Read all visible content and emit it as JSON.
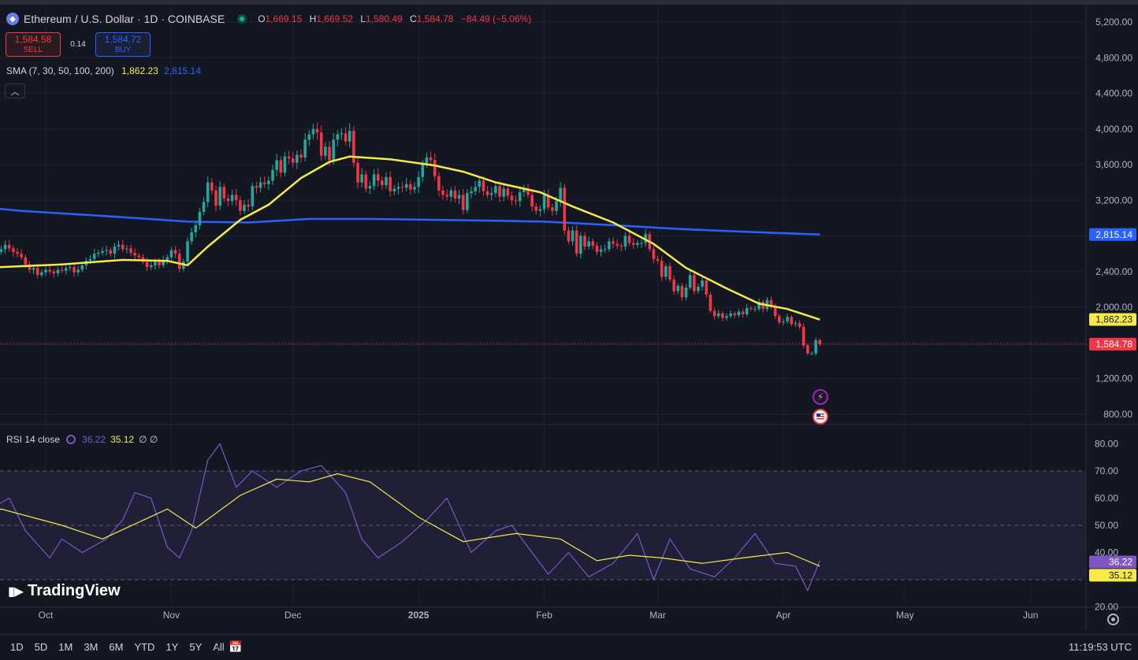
{
  "header": {
    "title": "Ethereum / U.S. Dollar · 1D · COINBASE",
    "ohlc": [
      {
        "k": "O",
        "v": "1,669.15"
      },
      {
        "k": "H",
        "v": "1,669.52"
      },
      {
        "k": "L",
        "v": "1,580.49"
      },
      {
        "k": "C",
        "v": "1,584.78"
      },
      {
        "k": "",
        "v": "−84.49 (−5.06%)"
      }
    ]
  },
  "trade": {
    "sell_price": "1,584.58",
    "sell_label": "SELL",
    "spread": "0.14",
    "buy_price": "1,584.72",
    "buy_label": "BUY"
  },
  "sma": {
    "label": "SMA (7, 30, 50, 100, 200)",
    "value1": "1,862.23",
    "value2": "2,815.14"
  },
  "rsi": {
    "label": "RSI 14 close",
    "value1": "36.22",
    "value2": "35.12",
    "extra": "∅ ∅"
  },
  "colors": {
    "up": "#26a69a",
    "down": "#f23645",
    "sma_short": "#f7e94a",
    "sma_long": "#2962ff",
    "rsi": "#7e57c2"
  },
  "logo": {
    "text": "TradingView"
  },
  "bottom": {
    "ranges": [
      "1D",
      "5D",
      "1M",
      "3M",
      "6M",
      "YTD",
      "1Y",
      "5Y",
      "All"
    ],
    "clock": "11:19:53 UTC"
  },
  "chart_data": {
    "type": "candlestick",
    "price_axis": {
      "ticks": [
        800,
        1200,
        1600,
        2000,
        2400,
        2800,
        3200,
        3600,
        4000,
        4400,
        4800,
        5200
      ],
      "tick_labels": [
        "800.00",
        "1,200.00",
        "",
        "2,000.00",
        "2,400.00",
        "",
        "3,200.00",
        "3,600.00",
        "4,000.00",
        "4,400.00",
        "4,800.00",
        "5,200.00"
      ],
      "range": [
        640,
        5360
      ]
    },
    "price_labels": [
      {
        "value": 2815.14,
        "text": "2,815.14",
        "color": "#2962ff",
        "text_color": "#ffffff"
      },
      {
        "value": 1862.23,
        "text": "1,862.23",
        "color": "#f7e94a",
        "text_color": "#131722"
      },
      {
        "value": 1584.78,
        "text": "1,584.78",
        "color": "#f23645",
        "text_color": "#ffffff"
      }
    ],
    "last_price": 1584.78,
    "time_axis": [
      "Oct",
      "Nov",
      "Dec",
      "2025",
      "Feb",
      "Mar",
      "Apr",
      "May",
      "Jun"
    ],
    "time_axis_dates": [
      "2024-10-01",
      "2024-11-01",
      "2024-12-01",
      "2025-01-01",
      "2025-02-01",
      "2025-03-01",
      "2025-04-01",
      "2025-05-01",
      "2025-06-01"
    ],
    "date_range": [
      "2024-09-06",
      "2025-06-21"
    ],
    "last_candle_date": "2025-04-10",
    "closes": [
      2430,
      2470,
      2480,
      2500,
      2520,
      2560,
      2580,
      2590,
      2610,
      2640,
      2660,
      2620,
      2590,
      2600,
      2620,
      2650,
      2700,
      2660,
      2620,
      2600,
      2560,
      2480,
      2420,
      2440,
      2360,
      2390,
      2420,
      2400,
      2380,
      2420,
      2410,
      2440,
      2450,
      2390,
      2420,
      2470,
      2520,
      2540,
      2600,
      2610,
      2630,
      2640,
      2600,
      2680,
      2700,
      2650,
      2660,
      2610,
      2580,
      2560,
      2510,
      2450,
      2470,
      2510,
      2470,
      2530,
      2560,
      2640,
      2600,
      2430,
      2510,
      2740,
      2840,
      2920,
      3070,
      3180,
      3400,
      3310,
      3140,
      3350,
      3220,
      3190,
      3260,
      3200,
      3080,
      3150,
      3130,
      3360,
      3340,
      3400,
      3380,
      3420,
      3540,
      3650,
      3510,
      3690,
      3670,
      3620,
      3710,
      3680,
      3880,
      3940,
      4000,
      3960,
      3700,
      3800,
      3650,
      3880,
      3940,
      3950,
      3860,
      3980,
      3620,
      3400,
      3490,
      3330,
      3360,
      3490,
      3420,
      3370,
      3460,
      3300,
      3330,
      3350,
      3340,
      3380,
      3320,
      3350,
      3460,
      3610,
      3680,
      3650,
      3470,
      3310,
      3260,
      3240,
      3310,
      3220,
      3260,
      3090,
      3280,
      3300,
      3350,
      3420,
      3300,
      3260,
      3280,
      3360,
      3240,
      3330,
      3250,
      3200,
      3190,
      3290,
      3330,
      3260,
      3130,
      3080,
      3100,
      3260,
      3120,
      3080,
      3190,
      3340,
      2860,
      2740,
      2860,
      2600,
      2800,
      2680,
      2740,
      2690,
      2620,
      2650,
      2650,
      2740,
      2710,
      2690,
      2680,
      2800,
      2720,
      2700,
      2720,
      2720,
      2820,
      2650,
      2540,
      2520,
      2340,
      2460,
      2310,
      2180,
      2240,
      2110,
      2220,
      2360,
      2180,
      2230,
      2300,
      2140,
      1960,
      1900,
      1930,
      1880,
      1900,
      1930,
      1910,
      1950,
      1920,
      1990,
      1980,
      1980,
      2060,
      1980,
      2080,
      2000,
      1900,
      1830,
      1840,
      1890,
      1810,
      1820,
      1780,
      1570,
      1480,
      1480,
      1630,
      1584
    ],
    "sma_short": {
      "name": "SMA",
      "points": [
        [
          "2024-09-06",
          2460
        ],
        [
          "2024-09-20",
          2450
        ],
        [
          "2024-10-05",
          2480
        ],
        [
          "2024-10-20",
          2530
        ],
        [
          "2024-10-31",
          2520
        ],
        [
          "2024-11-05",
          2470
        ],
        [
          "2024-11-10",
          2680
        ],
        [
          "2024-11-18",
          2980
        ],
        [
          "2024-11-25",
          3150
        ],
        [
          "2024-12-03",
          3450
        ],
        [
          "2024-12-10",
          3630
        ],
        [
          "2024-12-15",
          3690
        ],
        [
          "2024-12-25",
          3660
        ],
        [
          "2025-01-05",
          3590
        ],
        [
          "2025-01-12",
          3520
        ],
        [
          "2025-01-20",
          3400
        ],
        [
          "2025-01-31",
          3290
        ],
        [
          "2025-02-08",
          3130
        ],
        [
          "2025-02-18",
          2950
        ],
        [
          "2025-02-28",
          2710
        ],
        [
          "2025-03-08",
          2440
        ],
        [
          "2025-03-18",
          2210
        ],
        [
          "2025-03-26",
          2040
        ],
        [
          "2025-04-02",
          1980
        ],
        [
          "2025-04-10",
          1860
        ]
      ]
    },
    "sma_long": {
      "name": "SMA",
      "points": [
        [
          "2024-09-06",
          3160
        ],
        [
          "2024-09-25",
          3080
        ],
        [
          "2024-10-20",
          3010
        ],
        [
          "2024-11-05",
          2960
        ],
        [
          "2024-11-20",
          2950
        ],
        [
          "2024-12-05",
          2990
        ],
        [
          "2024-12-20",
          2990
        ],
        [
          "2025-01-05",
          2980
        ],
        [
          "2025-01-20",
          2970
        ],
        [
          "2025-02-01",
          2960
        ],
        [
          "2025-02-18",
          2920
        ],
        [
          "2025-03-05",
          2880
        ],
        [
          "2025-03-20",
          2850
        ],
        [
          "2025-04-10",
          2815
        ]
      ]
    },
    "rsi": {
      "axis_ticks": [
        20,
        30,
        40,
        50,
        60,
        70,
        80
      ],
      "axis_labels": [
        "20.00",
        "",
        "40.00",
        "50.00",
        "60.00",
        "70.00",
        "80.00"
      ],
      "range": [
        18,
        82
      ],
      "band": [
        30,
        70
      ],
      "value_labels": [
        {
          "value": 36.22,
          "text": "36.22",
          "color": "#7e57c2",
          "text_color": "#ffffff"
        },
        {
          "value": 35.12,
          "text": "35.12",
          "color": "#f7e94a",
          "text_color": "#131722"
        }
      ],
      "rsi_points": [
        [
          "2024-09-06",
          58
        ],
        [
          "2024-09-12",
          62
        ],
        [
          "2024-09-16",
          55
        ],
        [
          "2024-09-22",
          60
        ],
        [
          "2024-09-26",
          48
        ],
        [
          "2024-10-02",
          38
        ],
        [
          "2024-10-05",
          45
        ],
        [
          "2024-10-10",
          40
        ],
        [
          "2024-10-16",
          45
        ],
        [
          "2024-10-20",
          52
        ],
        [
          "2024-10-23",
          62
        ],
        [
          "2024-10-27",
          60
        ],
        [
          "2024-10-31",
          42
        ],
        [
          "2024-11-03",
          38
        ],
        [
          "2024-11-06",
          48
        ],
        [
          "2024-11-10",
          74
        ],
        [
          "2024-11-13",
          80
        ],
        [
          "2024-11-17",
          64
        ],
        [
          "2024-11-21",
          70
        ],
        [
          "2024-11-27",
          64
        ],
        [
          "2024-12-03",
          70
        ],
        [
          "2024-12-08",
          72
        ],
        [
          "2024-12-14",
          62
        ],
        [
          "2024-12-18",
          45
        ],
        [
          "2024-12-22",
          38
        ],
        [
          "2024-12-28",
          44
        ],
        [
          "2025-01-03",
          52
        ],
        [
          "2025-01-08",
          60
        ],
        [
          "2025-01-14",
          40
        ],
        [
          "2025-01-20",
          48
        ],
        [
          "2025-01-24",
          50
        ],
        [
          "2025-01-29",
          40
        ],
        [
          "2025-02-02",
          32
        ],
        [
          "2025-02-07",
          40
        ],
        [
          "2025-02-12",
          31
        ],
        [
          "2025-02-18",
          36
        ],
        [
          "2025-02-24",
          47
        ],
        [
          "2025-02-28",
          30
        ],
        [
          "2025-03-04",
          45
        ],
        [
          "2025-03-09",
          34
        ],
        [
          "2025-03-15",
          31
        ],
        [
          "2025-03-20",
          38
        ],
        [
          "2025-03-25",
          47
        ],
        [
          "2025-03-30",
          36
        ],
        [
          "2025-04-04",
          35
        ],
        [
          "2025-04-07",
          26
        ],
        [
          "2025-04-10",
          37
        ]
      ],
      "ma_points": [
        [
          "2024-09-06",
          45
        ],
        [
          "2024-09-20",
          56
        ],
        [
          "2024-10-05",
          50
        ],
        [
          "2024-10-15",
          45
        ],
        [
          "2024-10-31",
          56
        ],
        [
          "2024-11-07",
          49
        ],
        [
          "2024-11-18",
          61
        ],
        [
          "2024-11-27",
          67
        ],
        [
          "2024-12-05",
          66
        ],
        [
          "2024-12-12",
          69
        ],
        [
          "2024-12-20",
          66
        ],
        [
          "2025-01-01",
          53
        ],
        [
          "2025-01-12",
          44
        ],
        [
          "2025-01-25",
          47
        ],
        [
          "2025-02-05",
          45
        ],
        [
          "2025-02-14",
          37
        ],
        [
          "2025-02-22",
          39
        ],
        [
          "2025-03-02",
          38
        ],
        [
          "2025-03-12",
          36
        ],
        [
          "2025-03-22",
          38
        ],
        [
          "2025-04-02",
          40
        ],
        [
          "2025-04-10",
          35
        ]
      ]
    }
  }
}
